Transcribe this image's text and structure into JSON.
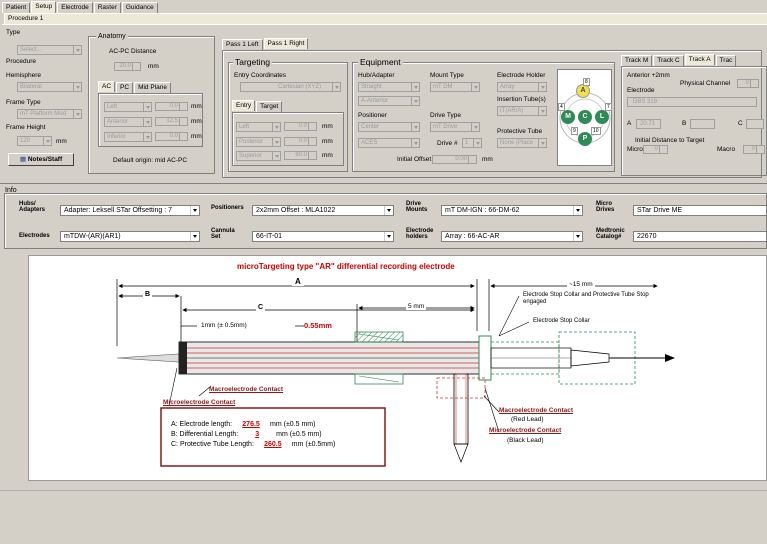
{
  "tabs": {
    "top": [
      "Patient",
      "Setup",
      "Electrode",
      "Raster",
      "Guidance"
    ],
    "sub": "Procedure 1"
  },
  "type": {
    "label": "Type",
    "value": "Select..."
  },
  "procedure": {
    "label": "Procedure",
    "hemisphere_label": "Hemisphere",
    "hemisphere": "Bilateral",
    "frame_type_label": "Frame Type",
    "frame_type": "mT Platform Mod",
    "frame_height_label": "Frame Height",
    "frame_height": "120",
    "frame_height_unit": "mm"
  },
  "notes_button": "Notes/Staff",
  "anatomy": {
    "title": "Anatomy",
    "acpc_label": "AC-PC Distance",
    "acpc_value": "20.0",
    "acpc_unit": "mm",
    "tabs": [
      "AC",
      "PC",
      "Mid Plane"
    ],
    "rows": [
      {
        "dir": "Left",
        "val": "0.0",
        "unit": "mm"
      },
      {
        "dir": "Anterior",
        "val": "12.5",
        "unit": "mm"
      },
      {
        "dir": "Inferior",
        "val": "0.0",
        "unit": "mm"
      }
    ],
    "origin": "Default origin: mid AC-PC"
  },
  "pass_tabs": [
    "Pass 1 Left",
    "Pass 1 Right"
  ],
  "targeting": {
    "title": "Targeting",
    "entry_label": "Entry Coordinates",
    "entry_value": "Cartesian (XYZ)",
    "tabs": [
      "Entry",
      "Target"
    ],
    "rows": [
      {
        "dir": "Left",
        "val": "0.0",
        "unit": "mm"
      },
      {
        "dir": "Posterior",
        "val": "0.0",
        "unit": "mm"
      },
      {
        "dir": "Superior",
        "val": "60.0",
        "unit": "mm"
      }
    ]
  },
  "equipment": {
    "title": "Equipment",
    "hub_label": "Hub/Adapter",
    "hub": "Straight",
    "hub2": "A-Anterior",
    "mount_label": "Mount Type",
    "mount": "mT DM",
    "holder_label": "Electrode Holder",
    "holder": "Array",
    "insertion_label": "Insertion Tube(s)",
    "insertion": "IT(AR/A)",
    "positioner_label": "Positioner",
    "positioner": "Center",
    "positioner2": "ACES",
    "drive_type_label": "Drive Type",
    "drive_type": "mT Drive",
    "drive_num_label": "Drive #",
    "drive_num": "1",
    "prot_label": "Protective Tube",
    "prot": "None (Place",
    "offset_label": "Initial Offset",
    "offset_val": "0.00",
    "offset_unit": "mm"
  },
  "array_ports": {
    "top": "A",
    "left": "M",
    "center": "C",
    "right": "L",
    "bottom": "P",
    "num_top": "8",
    "num_right": "7",
    "num_br": "10",
    "num_bl": "9",
    "num_l": "4"
  },
  "tracks": {
    "tabs": [
      "Track M",
      "Track C",
      "Track A",
      "Trac"
    ],
    "anterior": "Anterior +2mm",
    "channel_label": "Physical Channel",
    "channel": "0",
    "electrode_label": "Electrode",
    "electrode": "DBS 319",
    "a_label": "A",
    "a_val": "20.71",
    "b_label": "B",
    "c_label": "C",
    "init_dist": "Initial Distance to Target",
    "micro_label": "Micro",
    "micro": "0",
    "macro_label": "Macro",
    "macro": "0"
  },
  "info": {
    "title": "Info",
    "hubs_label": "Hubs/ Adapters",
    "hubs": "Adapter: Leksell STar Offsetting : 7",
    "positioners_label": "Positioners",
    "positioners": "2x2mm Offset : MLA1022",
    "drive_mounts_label": "Drive Mounts",
    "drive_mounts": "mT DM-IGN : 66-DM-62",
    "micro_drives_label": "Micro Drives",
    "micro_drives": "STar Drive ME",
    "electrodes_label": "Electrodes",
    "electrodes": "mTDW-(AR)(AR1)",
    "cannula_label": "Cannula Set",
    "cannula": "66-IT-01",
    "holders_label": "Electrode holders",
    "holders": "Array : 66-AC-AR",
    "catalog_label": "Medtronic Catalog#",
    "catalog": "22670"
  },
  "diagram": {
    "title": "microTargeting type \"AR\" differential recording electrode",
    "A": "A",
    "B": "B",
    "C": "C",
    "d15": "~15 mm",
    "d5": "5 mm",
    "d1": "1mm (± 0.5mm)",
    "d055": "0.55mm",
    "collar_engaged": "Electrode Stop Collar and Protective Tube Stop engaged",
    "collar": "Electrode Stop Collar",
    "macro_contact": "Macroelectrode Contact",
    "micro_contact": "Microelectrode Contact",
    "red_lead": "(Red Lead)",
    "black_lead": "(Black Lead)",
    "specs": [
      {
        "pre": "A: Electrode length:",
        "val": "276.5",
        "post": "mm (±0.5 mm)"
      },
      {
        "pre": "B: Differential Length:",
        "val": "3",
        "post": "mm (±0.5 mm)"
      },
      {
        "pre": "C: Protective Tube Length:",
        "val": "260.5",
        "post": "mm (±0.5mm)"
      }
    ]
  },
  "colors": {
    "red": "#cc0000",
    "dark_red": "#8b1a1a",
    "link": "#cc3333",
    "bg": "#d4d0c8",
    "accent_green": "#2e8b57",
    "accent_yellow": "#f0e050"
  }
}
